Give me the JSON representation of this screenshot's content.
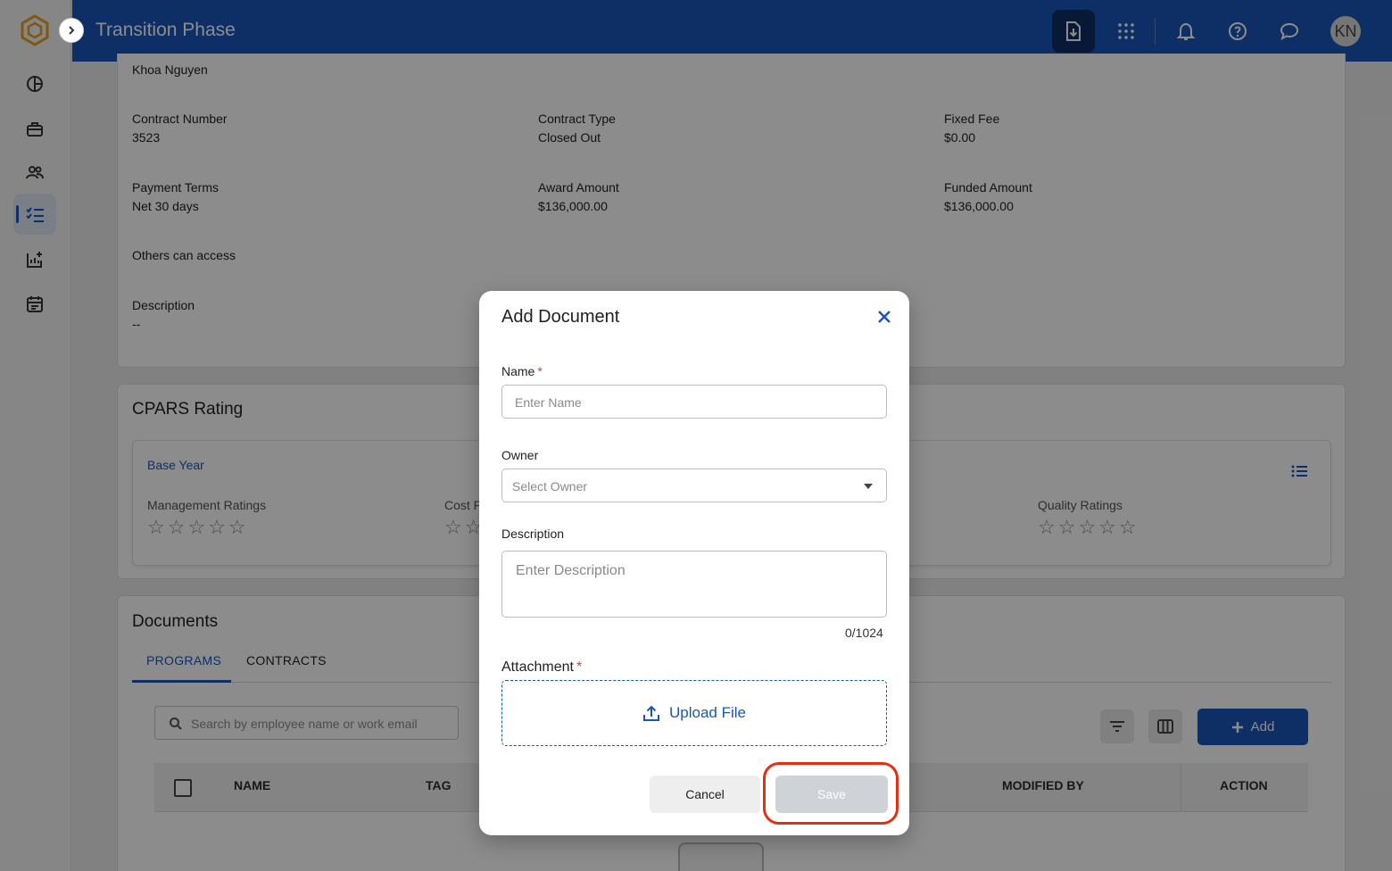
{
  "app": {
    "title": "Transition Phase",
    "avatar_initials": "KN"
  },
  "contract": {
    "owner_name": "Khoa Nguyen",
    "fields": [
      {
        "label": "Contract Number",
        "value": "3523"
      },
      {
        "label": "Contract Type",
        "value": "Closed Out"
      },
      {
        "label": "Fixed Fee",
        "value": "$0.00"
      },
      {
        "label": "Payment Terms",
        "value": "Net 30 days"
      },
      {
        "label": "Award Amount",
        "value": "$136,000.00"
      },
      {
        "label": "Funded Amount",
        "value": "$136,000.00"
      }
    ],
    "others_label": "Others can access",
    "description_label": "Description",
    "description_value": "--"
  },
  "cpars": {
    "title": "CPARS Rating",
    "period": "Base Year",
    "ratings": [
      {
        "label": "Management Ratings",
        "stars": 0,
        "max": 5
      },
      {
        "label": "Cost F",
        "stars": 0,
        "max": 5
      },
      {
        "label": "Quality Ratings",
        "stars": 0,
        "max": 5
      }
    ],
    "star_glyphs": "☆☆☆☆☆",
    "star_glyphs_partial": "☆☆"
  },
  "documents": {
    "title": "Documents",
    "tabs": [
      "PROGRAMS",
      "CONTRACTS"
    ],
    "active_tab": 0,
    "search_placeholder": "Search by employee name or work email",
    "add_label": "Add",
    "columns": [
      "NAME",
      "TAG",
      "MODIFIED BY",
      "ACTION"
    ]
  },
  "modal": {
    "title": "Add Document",
    "name_label": "Name",
    "name_placeholder": "Enter Name",
    "owner_label": "Owner",
    "owner_placeholder": "Select Owner",
    "description_label": "Description",
    "description_placeholder": "Enter Description",
    "counter": "0/1024",
    "attachment_label": "Attachment",
    "required_mark": "*",
    "upload_label": "Upload File",
    "cancel_label": "Cancel",
    "save_label": "Save"
  },
  "colors": {
    "brand": "#1a56b8",
    "highlight": "#e62e12",
    "required": "#e53935"
  }
}
